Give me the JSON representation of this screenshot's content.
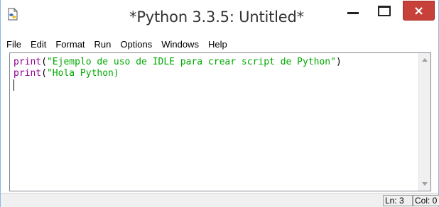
{
  "window": {
    "title": "*Python 3.3.5: Untitled*",
    "close_glyph": "×"
  },
  "menubar": {
    "items": [
      "File",
      "Edit",
      "Format",
      "Run",
      "Options",
      "Windows",
      "Help"
    ]
  },
  "editor": {
    "lines": [
      {
        "keyword": "print",
        "open": "(",
        "string": "\"Ejemplo de uso de IDLE para crear script de Python\"",
        "close": ")"
      },
      {
        "keyword": "print",
        "open": "(",
        "string": "\"Hola Python)",
        "close": ""
      }
    ]
  },
  "statusbar": {
    "line": "Ln: 3",
    "col": "Col: 0"
  },
  "colors": {
    "keyword": "#900090",
    "string": "#00aa00",
    "close_button": "#c7403a",
    "frame": "#8fb7e3"
  }
}
